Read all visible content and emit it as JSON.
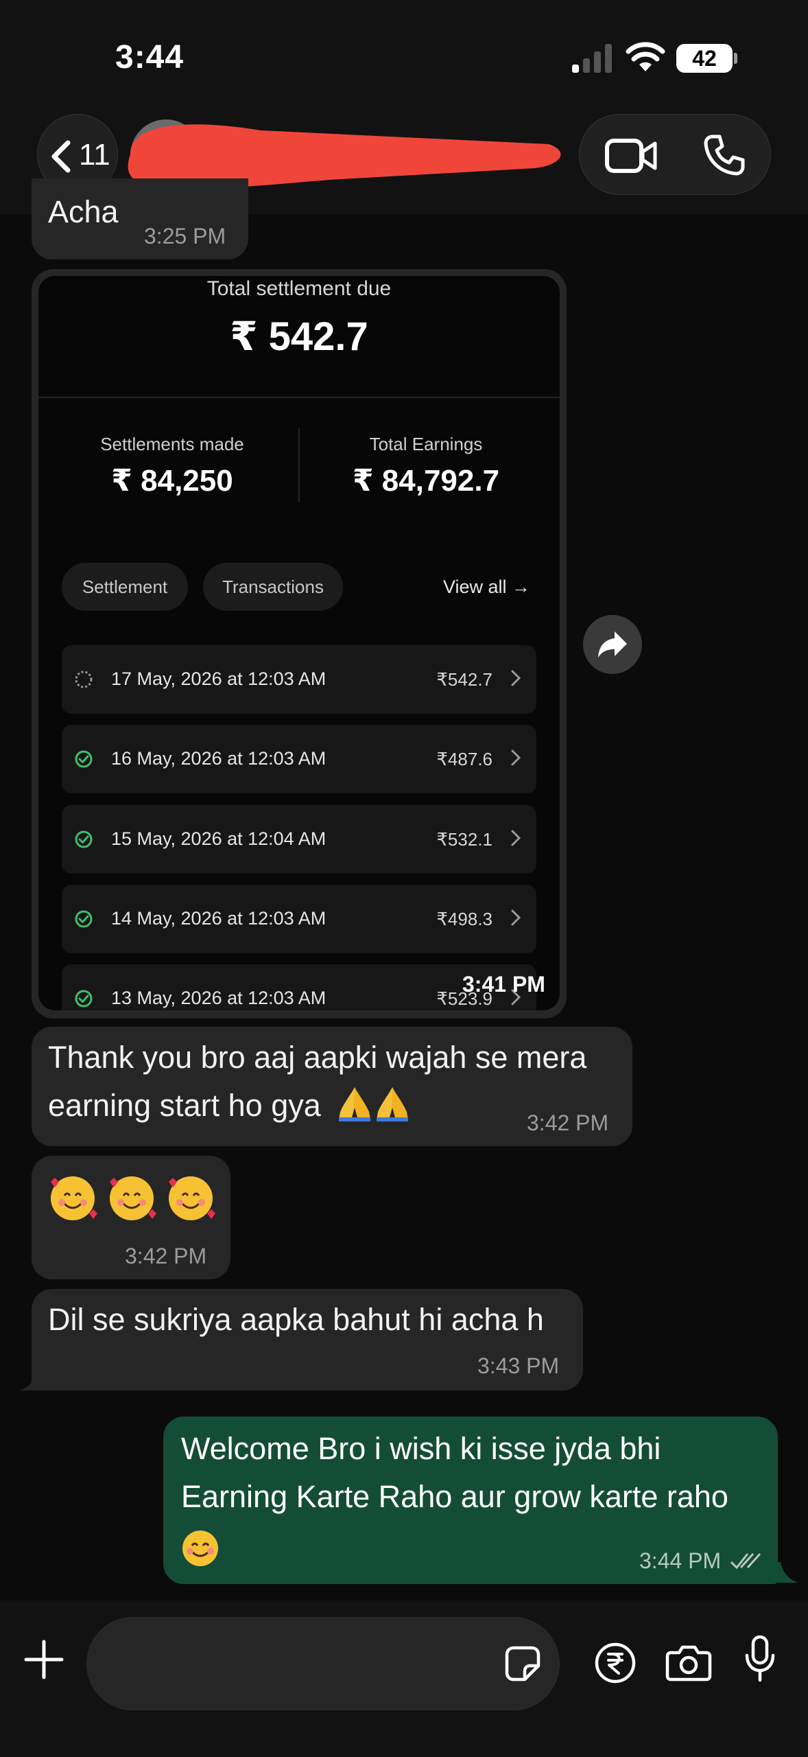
{
  "status_bar": {
    "time": "3:44",
    "battery": "42"
  },
  "header": {
    "back_count": "11",
    "contact_name": ""
  },
  "messages": {
    "acha": {
      "text": "Acha",
      "time": "3:25 PM"
    },
    "screenshot": {
      "time": "3:41 PM",
      "title": "Total settlement due",
      "total": "₹ 542.7",
      "settlements_label": "Settlements made",
      "settlements_value": "₹ 84,250",
      "earnings_label": "Total Earnings",
      "earnings_value": "₹ 84,792.7",
      "tabs": [
        "Settlement",
        "Transactions"
      ],
      "view_all": "View all →",
      "rows": [
        {
          "date": "17 May, 2026 at 12:03 AM",
          "amount": "₹542.7",
          "status": "pending"
        },
        {
          "date": "16 May, 2026 at 12:03 AM",
          "amount": "₹487.6",
          "status": "done"
        },
        {
          "date": "15 May, 2026 at 12:04 AM",
          "amount": "₹532.1",
          "status": "done"
        },
        {
          "date": "14 May, 2026 at 12:03 AM",
          "amount": "₹498.3",
          "status": "done"
        },
        {
          "date": "13 May, 2026 at 12:03 AM",
          "amount": "₹523.9",
          "status": "done"
        }
      ]
    },
    "thanks": {
      "line1": "Thank you bro aaj aapki wajah se mera",
      "line2": "earning start ho gya",
      "time": "3:42 PM"
    },
    "emoji": {
      "time": "3:42 PM"
    },
    "dil": {
      "text": "Dil se sukriya aapka bahut hi acha h",
      "time": "3:43 PM"
    },
    "welcome": {
      "line1": "Welcome Bro i wish ki isse jyda bhi",
      "line2": "Earning Karte Raho aur grow karte raho",
      "time": "3:44 PM"
    }
  },
  "colors": {
    "outgoing_bubble": "#144d37",
    "incoming_bubble": "#262626",
    "success": "#3fbf6f"
  },
  "icons": [
    "chevron-left-icon",
    "video-icon",
    "phone-icon",
    "share-icon",
    "plus-icon",
    "sticker-icon",
    "rupee-icon",
    "camera-icon",
    "mic-icon",
    "double-check-icon"
  ]
}
